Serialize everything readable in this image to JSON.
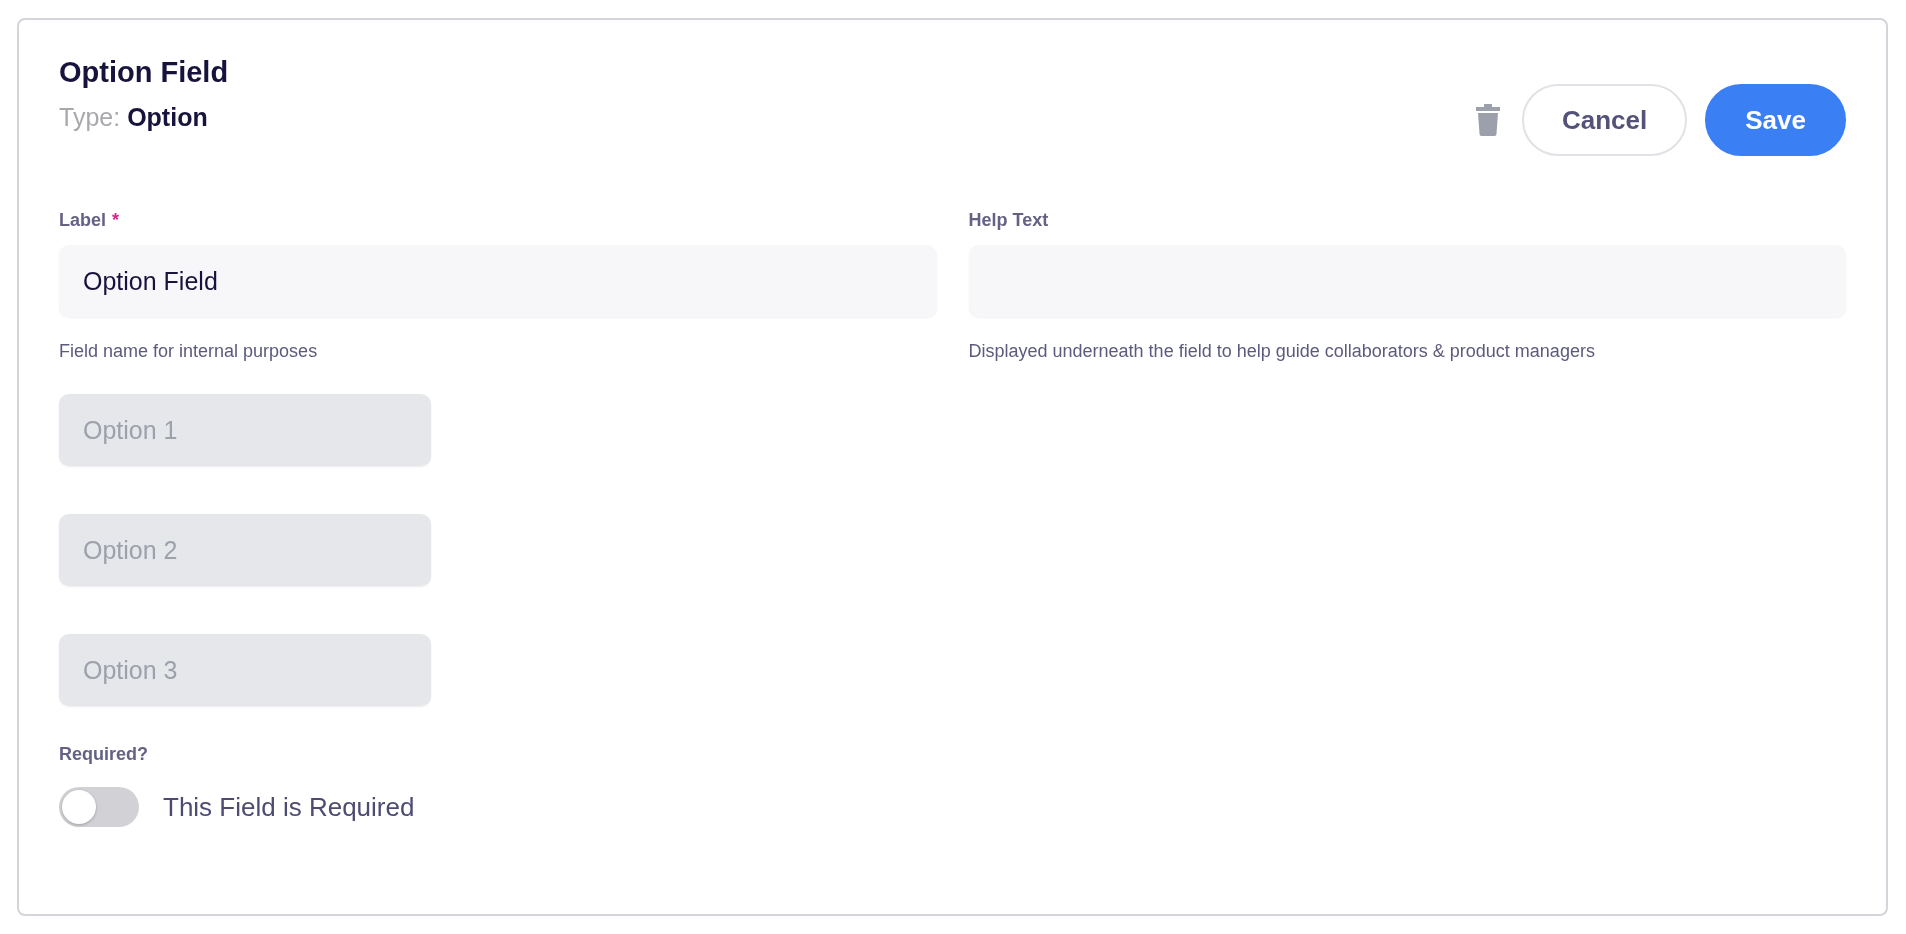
{
  "header": {
    "title": "Option Field",
    "type_label": "Type:",
    "type_value": "Option"
  },
  "actions": {
    "cancel": "Cancel",
    "save": "Save"
  },
  "fields": [
    {
      "label": "Label",
      "marker": "*",
      "value": "Option Field",
      "hint": "Field name for internal purposes"
    },
    {
      "label": "Help Text",
      "hint": "Displayed underneath the field to help guide collaborators & product managers"
    }
  ],
  "options": [
    {
      "placeholder": "Option 1",
      "disabled": true
    },
    {
      "placeholder": "Option 2",
      "disabled": true
    },
    {
      "placeholder": "Option 3",
      "disabled": true
    }
  ],
  "required_section": {
    "label": "Required?",
    "toggle": {
      "label": "This Field is Required",
      "on": false
    }
  }
}
